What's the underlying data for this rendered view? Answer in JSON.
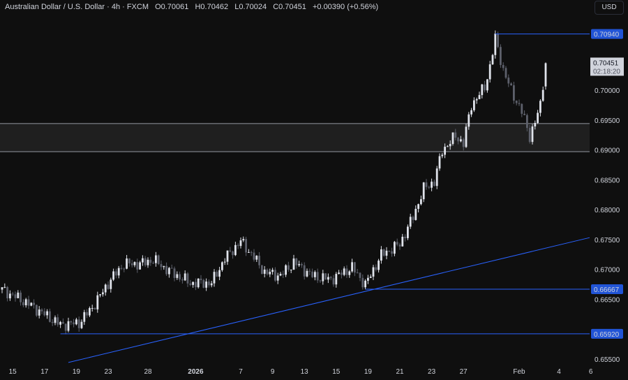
{
  "header": {
    "symbol": "Australian Dollar / U.S. Dollar · 4h · FXCM",
    "open": "O0.70061",
    "high": "H0.70462",
    "low": "L0.70024",
    "close": "C0.70451",
    "change": "+0.00390 (+0.56%)"
  },
  "currency_button": "USD",
  "price_axis": {
    "ticks": [
      "0.70000",
      "0.69500",
      "0.69000",
      "0.68500",
      "0.68000",
      "0.67500",
      "0.67000",
      "0.66500",
      "0.65500"
    ],
    "tick_values": [
      0.7,
      0.695,
      0.69,
      0.685,
      0.68,
      0.675,
      0.67,
      0.665,
      0.655
    ]
  },
  "time_axis": {
    "labels": [
      "15",
      "17",
      "19",
      "23",
      "28",
      "2026",
      "7",
      "9",
      "13",
      "15",
      "19",
      "21",
      "23",
      "27",
      "Feb",
      "4",
      "6"
    ],
    "bar_index": [
      4,
      16,
      28,
      40,
      55,
      73,
      90,
      102,
      114,
      126,
      138,
      150,
      162,
      174,
      195,
      210,
      222
    ]
  },
  "current_price": {
    "value": "0.70451",
    "countdown": "02:18:20"
  },
  "levels": [
    {
      "price": 0.7094,
      "label": "0.70940",
      "from_bar": 186
    },
    {
      "price": 0.66667,
      "label": "0.66667",
      "from_bar": 137
    },
    {
      "price": 0.6592,
      "label": "0.65920",
      "from_bar": 22
    }
  ],
  "zone": {
    "top": 0.6944,
    "bottom": 0.6897
  },
  "trendline": {
    "from": [
      25,
      0.6544
    ],
    "to": [
      222,
      0.6753
    ]
  },
  "colors": {
    "up": "#e0e3eb",
    "down": "#5d606b",
    "line": "#2962ff",
    "label_bg": "#2154d6"
  },
  "chart_data": {
    "type": "candlestick",
    "bars": 206,
    "close_anchors": [
      [
        0,
        0.6666
      ],
      [
        10,
        0.6642
      ],
      [
        22,
        0.6607
      ],
      [
        29,
        0.661
      ],
      [
        34,
        0.6636
      ],
      [
        41,
        0.6683
      ],
      [
        46,
        0.6709
      ],
      [
        52,
        0.6709
      ],
      [
        57,
        0.6716
      ],
      [
        63,
        0.6697
      ],
      [
        71,
        0.6677
      ],
      [
        79,
        0.6677
      ],
      [
        84,
        0.6718
      ],
      [
        90,
        0.6747
      ],
      [
        95,
        0.672
      ],
      [
        99,
        0.6695
      ],
      [
        105,
        0.6689
      ],
      [
        110,
        0.6712
      ],
      [
        117,
        0.6689
      ],
      [
        124,
        0.6683
      ],
      [
        132,
        0.6703
      ],
      [
        137,
        0.6674
      ],
      [
        143,
        0.6724
      ],
      [
        150,
        0.6742
      ],
      [
        155,
        0.6788
      ],
      [
        159,
        0.6835
      ],
      [
        163,
        0.6847
      ],
      [
        166,
        0.6899
      ],
      [
        171,
        0.6923
      ],
      [
        174,
        0.6911
      ],
      [
        177,
        0.6975
      ],
      [
        182,
        0.7005
      ],
      [
        184,
        0.704
      ],
      [
        186,
        0.7087
      ],
      [
        189,
        0.7034
      ],
      [
        192,
        0.6999
      ],
      [
        196,
        0.6964
      ],
      [
        199,
        0.6923
      ],
      [
        201,
        0.6946
      ],
      [
        203,
        0.6975
      ],
      [
        205,
        0.7045
      ]
    ]
  }
}
